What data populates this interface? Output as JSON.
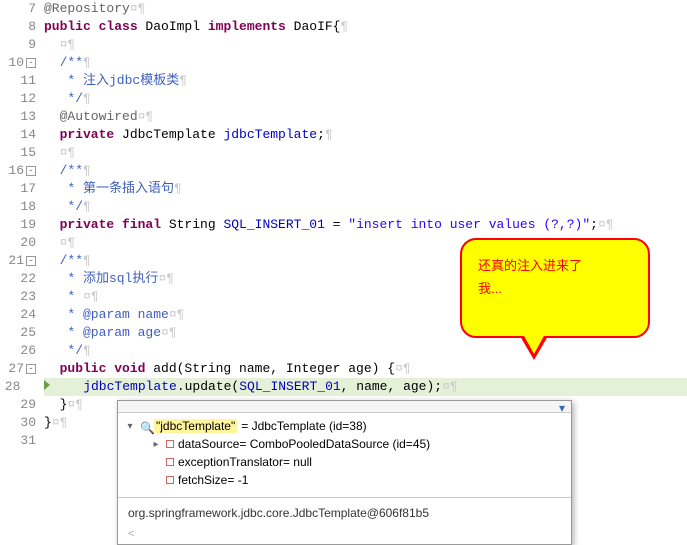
{
  "gutter": {
    "start": 7,
    "end": 31,
    "folds": [
      10,
      16,
      21,
      27
    ]
  },
  "code": {
    "l7": {
      "ann": "@Repository",
      "ws": "¤¶"
    },
    "l8": {
      "kw1": "public class",
      "cls": " DaoImpl ",
      "kw2": "implements",
      "impl": " DaoIF{",
      "ws": "¶"
    },
    "l9": {
      "ws": "  ¤¶"
    },
    "l10": {
      "cm": "  /**",
      "ws": "¶"
    },
    "l11": {
      "cm": "   * 注入jdbc模板类",
      "ws": "¶"
    },
    "l12": {
      "cm": "   */",
      "ws": "¶"
    },
    "l13": {
      "ann": "  @Autowired",
      "ws": "¤¶"
    },
    "l14": {
      "kw": "  private",
      "typ": " JdbcTemplate ",
      "fld": "jdbcTemplate",
      "end": ";",
      "ws": "¶"
    },
    "l15": {
      "ws": "  ¤¶"
    },
    "l16": {
      "cm": "  /**",
      "ws": "¶"
    },
    "l17": {
      "cm": "   * 第一条插入语句",
      "ws": "¶"
    },
    "l18": {
      "cm": "   */",
      "ws": "¶"
    },
    "l19": {
      "kw": "  private final",
      "typ": " String ",
      "fld": "SQL_INSERT_01",
      "eq": " = ",
      "str": "\"insert into user values (?,?)\"",
      "end": ";",
      "ws": "¤¶"
    },
    "l20": {
      "ws": "  ¤¶"
    },
    "l21": {
      "cm": "  /**",
      "ws": "¶"
    },
    "l22": {
      "cm": "   * 添加sql执行",
      "ws": "¤¶"
    },
    "l23": {
      "cm": "   * ",
      "ws": "¤¶"
    },
    "l24": {
      "cm": "   * @param name",
      "ws": "¤¶"
    },
    "l25": {
      "cm": "   * @param age",
      "ws": "¤¶"
    },
    "l26": {
      "cm": "   */",
      "ws": "¶"
    },
    "l27": {
      "kw": "  public void",
      "m": " add(String name, Integer age) {",
      "ws": "¤¶"
    },
    "l28": {
      "obj": "    jdbcTemplate",
      "call": ".update(",
      "a1": "SQL_INSERT_01",
      "c1": ", name, age);",
      "ws": "¤¶"
    },
    "l29": {
      "txt": "  }",
      "ws": "¤¶"
    },
    "l30": {
      "txt": "}",
      "ws": "¤¶"
    },
    "l31": {
      "txt": ""
    }
  },
  "callout": {
    "line1": "还真的注入进来了",
    "line2": "我..."
  },
  "popup": {
    "root": {
      "label": "\"jdbcTemplate\"",
      "eq": "= JdbcTemplate  (id=38)"
    },
    "children": [
      {
        "label": "dataSource= ComboPooledDataSource  (id=45)",
        "expandable": true
      },
      {
        "label": "exceptionTranslator= null",
        "expandable": false
      },
      {
        "label": "fetchSize= -1",
        "expandable": false
      }
    ],
    "footer": "org.springframework.jdbc.core.JdbcTemplate@606f81b5"
  }
}
